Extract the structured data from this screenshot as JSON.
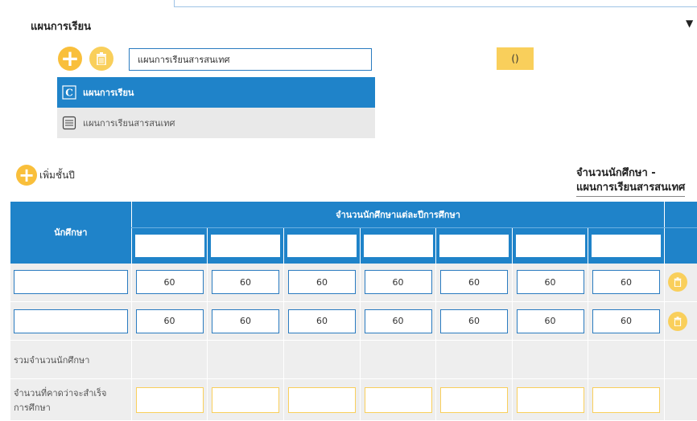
{
  "section": {
    "title": "แผนการเรียน"
  },
  "plan": {
    "input_value": "แผนการเรียนสารสนเทศ",
    "paren_button_label": "()",
    "list": [
      {
        "label": "แผนการเรียน",
        "icon": "curriculum-c-icon",
        "selected": true
      },
      {
        "label": "แผนการเรียนสารสนเทศ",
        "icon": "document-lines-icon",
        "selected": false
      }
    ]
  },
  "add_grade_label": "เพิ่มชั้นปี",
  "summary": {
    "line1": "จำนวนนักศึกษา -",
    "line2": "แผนการเรียนสารสนเทศ"
  },
  "table": {
    "student_header": "นักศึกษา",
    "year_header": "จำนวนนักศึกษาแต่ละปีการศึกษา",
    "rows": [
      {
        "values": [
          "60",
          "60",
          "60",
          "60",
          "60",
          "60",
          "60"
        ]
      },
      {
        "values": [
          "60",
          "60",
          "60",
          "60",
          "60",
          "60",
          "60"
        ]
      }
    ],
    "total_label": "รวมจำนวนนักศึกษา",
    "expected_label_line1": "จำนวนที่คาดว่าจะสำเร็จ",
    "expected_label_line2": "การศึกษา"
  },
  "colors": {
    "accent": "#1f83c9",
    "button": "#f9bf3b"
  }
}
